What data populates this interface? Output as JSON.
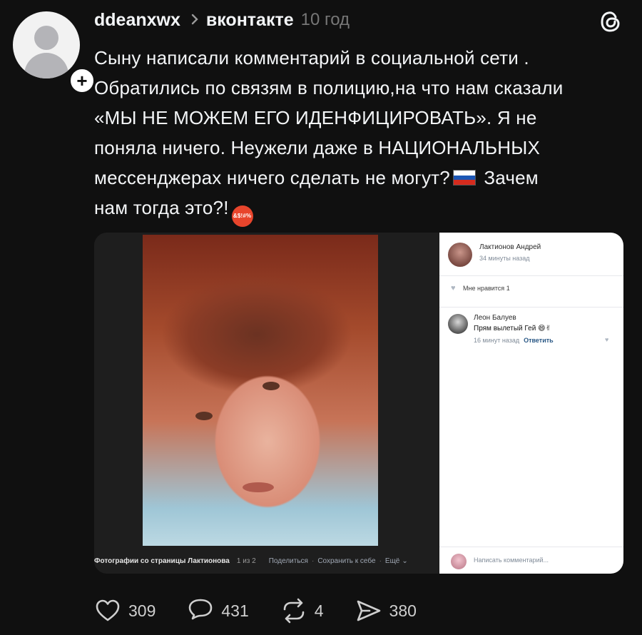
{
  "post": {
    "username": "ddeanxwx",
    "separator": ">",
    "community": "вконтакте",
    "time": "10 год",
    "lines": [
      "Сыну написали комментарий в социальной сети .",
      "Обратились по связям в полицию,на что нам сказали",
      "«МЫ НЕ МОЖЕМ ЕГО ИДЕНФИЦИРОВАТЬ». Я не",
      "поняла ничего. Неужели даже в НАЦИОНАЛЬНЫХ",
      "мессенджерах ничего сделать не могут?",
      "Зачем",
      "нам тогда это?!"
    ],
    "emoji_text": "&$!#%"
  },
  "screenshot": {
    "caption_title": "Фотографии со страницы Лактионова",
    "caption_counter": "1 из 2",
    "caption_share": "Поделиться",
    "caption_save": "Сохранить к себе",
    "caption_more": "Ещё",
    "author_name": "Лактионов Андрей",
    "author_time": "34 минуты назад",
    "likes_label": "Мне нравится",
    "likes_count": "1",
    "comment_author": "Леон Балуев",
    "comment_text": "Прям вылетый Гей",
    "comment_emoji": "😄✌",
    "comment_time": "16 минут назад",
    "comment_reply": "Ответить",
    "write_placeholder": "Написать комментарий..."
  },
  "actions": {
    "likes": "309",
    "comments": "431",
    "reposts": "4",
    "shares": "380"
  },
  "colors": {
    "background": "#101010",
    "text": "#f3f5f7",
    "muted": "#777777",
    "vk_link": "#2a5885"
  }
}
